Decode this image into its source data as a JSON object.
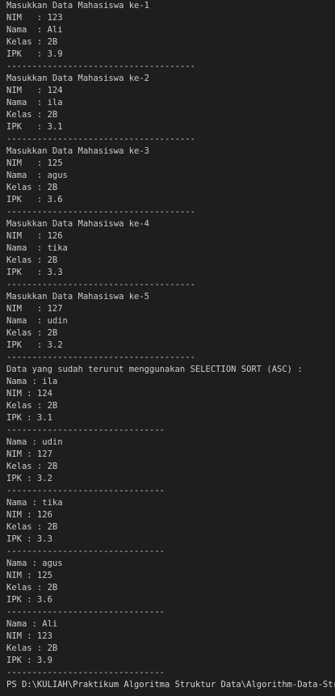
{
  "terminal": {
    "lines": [
      "Masukkan Data Mahasiswa ke-1",
      "NIM   : 123",
      "Nama  : Ali",
      "Kelas : 2B",
      "IPK   : 3.9",
      "-------------------------------------",
      "Masukkan Data Mahasiswa ke-2",
      "NIM   : 124",
      "Nama  : ila",
      "Kelas : 2B",
      "IPK   : 3.1",
      "-------------------------------------",
      "Masukkan Data Mahasiswa ke-3",
      "NIM   : 125",
      "Nama  : agus",
      "Kelas : 2B",
      "IPK   : 3.6",
      "-------------------------------------",
      "Masukkan Data Mahasiswa ke-4",
      "NIM   : 126",
      "Nama  : tika",
      "Kelas : 2B",
      "IPK   : 3.3",
      "-------------------------------------",
      "Masukkan Data Mahasiswa ke-5",
      "NIM   : 127",
      "Nama  : udin",
      "Kelas : 2B",
      "IPK   : 3.2",
      "-------------------------------------",
      "Data yang sudah terurut menggunakan SELECTION SORT (ASC) :",
      "Nama : ila",
      "NIM : 124",
      "Kelas : 2B",
      "IPK : 3.1",
      "-------------------------------",
      "Nama : udin",
      "NIM : 127",
      "Kelas : 2B",
      "IPK : 3.2",
      "-------------------------------",
      "Nama : tika",
      "NIM : 126",
      "Kelas : 2B",
      "IPK : 3.3",
      "-------------------------------",
      "Nama : agus",
      "NIM : 125",
      "Kelas : 2B",
      "IPK : 3.6",
      "-------------------------------",
      "Nama : Ali",
      "NIM : 123",
      "Kelas : 2B",
      "IPK : 3.9",
      "-------------------------------"
    ],
    "prompt": "PS D:\\KULIAH\\Praktikum Algoritma Struktur Data\\Algorithm-Data-Struct"
  },
  "colors": {
    "background": "#1e1e1e",
    "text": "#cccccc"
  }
}
